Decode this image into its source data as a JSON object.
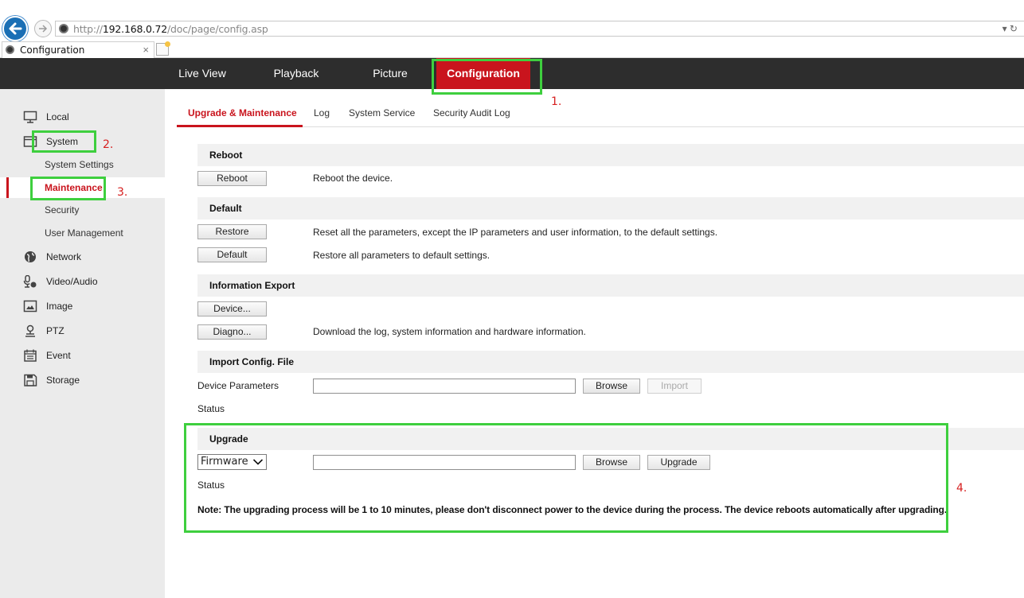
{
  "browser": {
    "url_prefix": "http://",
    "url_host": "192.168.0.72",
    "url_path": "/doc/page/config.asp",
    "url_controls": "▾ ↻",
    "tab_title": "Configuration",
    "tab_close": "×"
  },
  "topnav": {
    "items": [
      "Live View",
      "Playback",
      "Picture",
      "Configuration"
    ]
  },
  "sidebar": {
    "local": "Local",
    "system": "System",
    "system_sub": [
      "System Settings",
      "Maintenance",
      "Security",
      "User Management"
    ],
    "network": "Network",
    "video_audio": "Video/Audio",
    "image": "Image",
    "ptz": "PTZ",
    "event": "Event",
    "storage": "Storage"
  },
  "subtabs": [
    "Upgrade & Maintenance",
    "Log",
    "System Service",
    "Security Audit Log"
  ],
  "reboot": {
    "heading": "Reboot",
    "button": "Reboot",
    "desc": "Reboot the device."
  },
  "default": {
    "heading": "Default",
    "restore_button": "Restore",
    "restore_desc": "Reset all the parameters, except the IP parameters and user information, to the default settings.",
    "default_button": "Default",
    "default_desc": "Restore all parameters to default settings."
  },
  "info_export": {
    "heading": "Information Export",
    "device_button": "Device...",
    "diagno_button": "Diagno...",
    "diagno_desc": "Download the log, system information and hardware information."
  },
  "import_config": {
    "heading": "Import Config. File",
    "label": "Device Parameters",
    "value": "",
    "browse_button": "Browse",
    "import_button": "Import",
    "status_label": "Status"
  },
  "upgrade": {
    "heading": "Upgrade",
    "type_selected": "Firmware",
    "value": "",
    "browse_button": "Browse",
    "upgrade_button": "Upgrade",
    "status_label": "Status",
    "note": "Note: The upgrading process will be 1 to 10 minutes, please don't disconnect power to the device during the process. The device reboots automatically after upgrading."
  },
  "annotations": {
    "step1": "1.",
    "step2": "2.",
    "step3": "3.",
    "step4": "4."
  },
  "colors": {
    "accent": "#c9141d",
    "nav_bg": "#2d2d2d",
    "sidebar_bg": "#ebebeb",
    "highlight": "#3ecf3e",
    "annotation": "#d62020"
  }
}
